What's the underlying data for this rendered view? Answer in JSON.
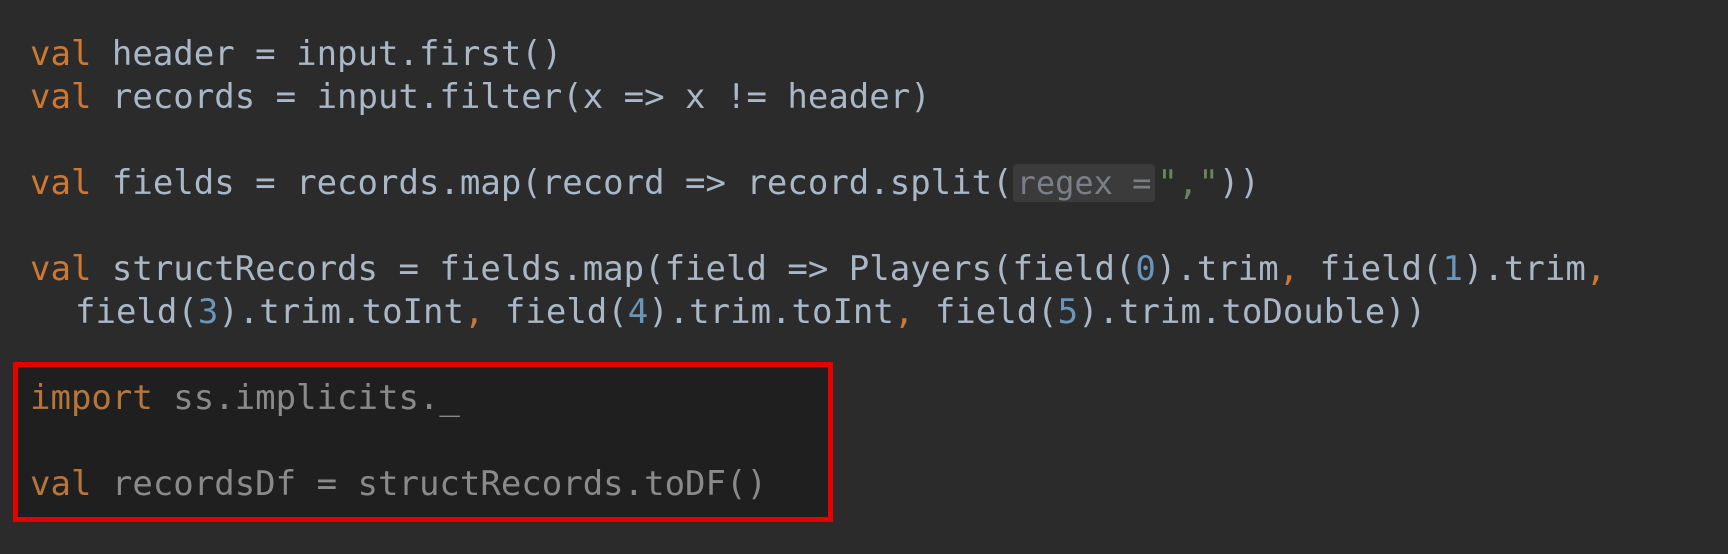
{
  "editor": {
    "lines": [
      {
        "kw": "val",
        "text": " header = input.first()"
      },
      {
        "kw": "val",
        "text": " records = input.filter(x => x != header)"
      },
      {
        "kw": "val",
        "pre": " fields = records.map(record => record.split(",
        "hint": "regex =",
        "str": "\",\"",
        "post": "))"
      },
      {
        "kw": "val",
        "text": " structRecords = fields.map(field => Players(field(",
        "n0": "0",
        "t1": ").trim",
        "c1": ",",
        "t2": " field(",
        "n1": "1",
        "t3": ").trim",
        "c2": ","
      },
      {
        "t1": "field(",
        "n3": "3",
        "t2": ").trim.toInt",
        "c1": ",",
        "t3": " field(",
        "n4": "4",
        "t4": ").trim.toInt",
        "c2": ",",
        "t5": " field(",
        "n5": "5",
        "t6": ").trim.toDouble))"
      }
    ],
    "highlighted": {
      "import_kw": "import",
      "import_text": " ss.implicits._",
      "val_kw": "val",
      "val_text": " recordsDf = structRecords.toDF()"
    }
  },
  "colors": {
    "background": "#2b2b2b",
    "keyword": "#cc7832",
    "number": "#6897bb",
    "string": "#6a8759",
    "highlight_border": "#e60000"
  }
}
